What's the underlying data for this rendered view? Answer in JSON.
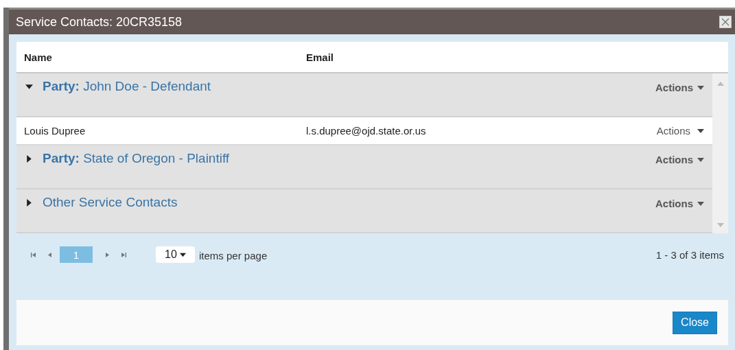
{
  "window": {
    "title": "Service Contacts: 20CR35158"
  },
  "table": {
    "columns": [
      "Name",
      "Email"
    ],
    "groups": [
      {
        "label": "**Party:** John Doe - Defendant",
        "expanded": true,
        "actions": "Actions",
        "contacts": [
          {
            "name": "Louis Dupree",
            "email": "l.s.dupree@ojd.state.or.us",
            "actions": "Actions"
          }
        ]
      },
      {
        "label": "**Party:** State of Oregon - Plaintiff",
        "expanded": false,
        "actions": "Actions"
      },
      {
        "label": "Other Service Contacts",
        "expanded": false,
        "actions": "Actions"
      }
    ]
  },
  "pager": {
    "pages": [
      {
        "label": "1",
        "selected": true
      }
    ],
    "page_size": "10",
    "page_size_label": "items per page",
    "info": "1 - 3 of 3 items"
  },
  "buttons": [
    "Close"
  ]
}
